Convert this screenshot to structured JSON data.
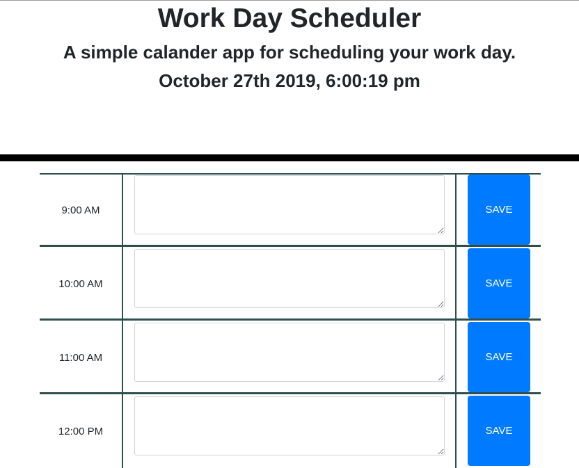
{
  "header": {
    "title": "Work Day Scheduler",
    "subtitle": "A simple calander app for scheduling your work day.",
    "datetime": "October 27th 2019, 6:00:19 pm"
  },
  "schedule": {
    "rows": [
      {
        "hour": "9:00 AM",
        "description": "",
        "save_label": "SAVE"
      },
      {
        "hour": "10:00 AM",
        "description": "",
        "save_label": "SAVE"
      },
      {
        "hour": "11:00 AM",
        "description": "",
        "save_label": "SAVE"
      },
      {
        "hour": "12:00 PM",
        "description": "",
        "save_label": "SAVE"
      }
    ]
  },
  "colors": {
    "save_button": "#007bff",
    "row_border": "#2f4f4f",
    "divider": "#000000"
  }
}
